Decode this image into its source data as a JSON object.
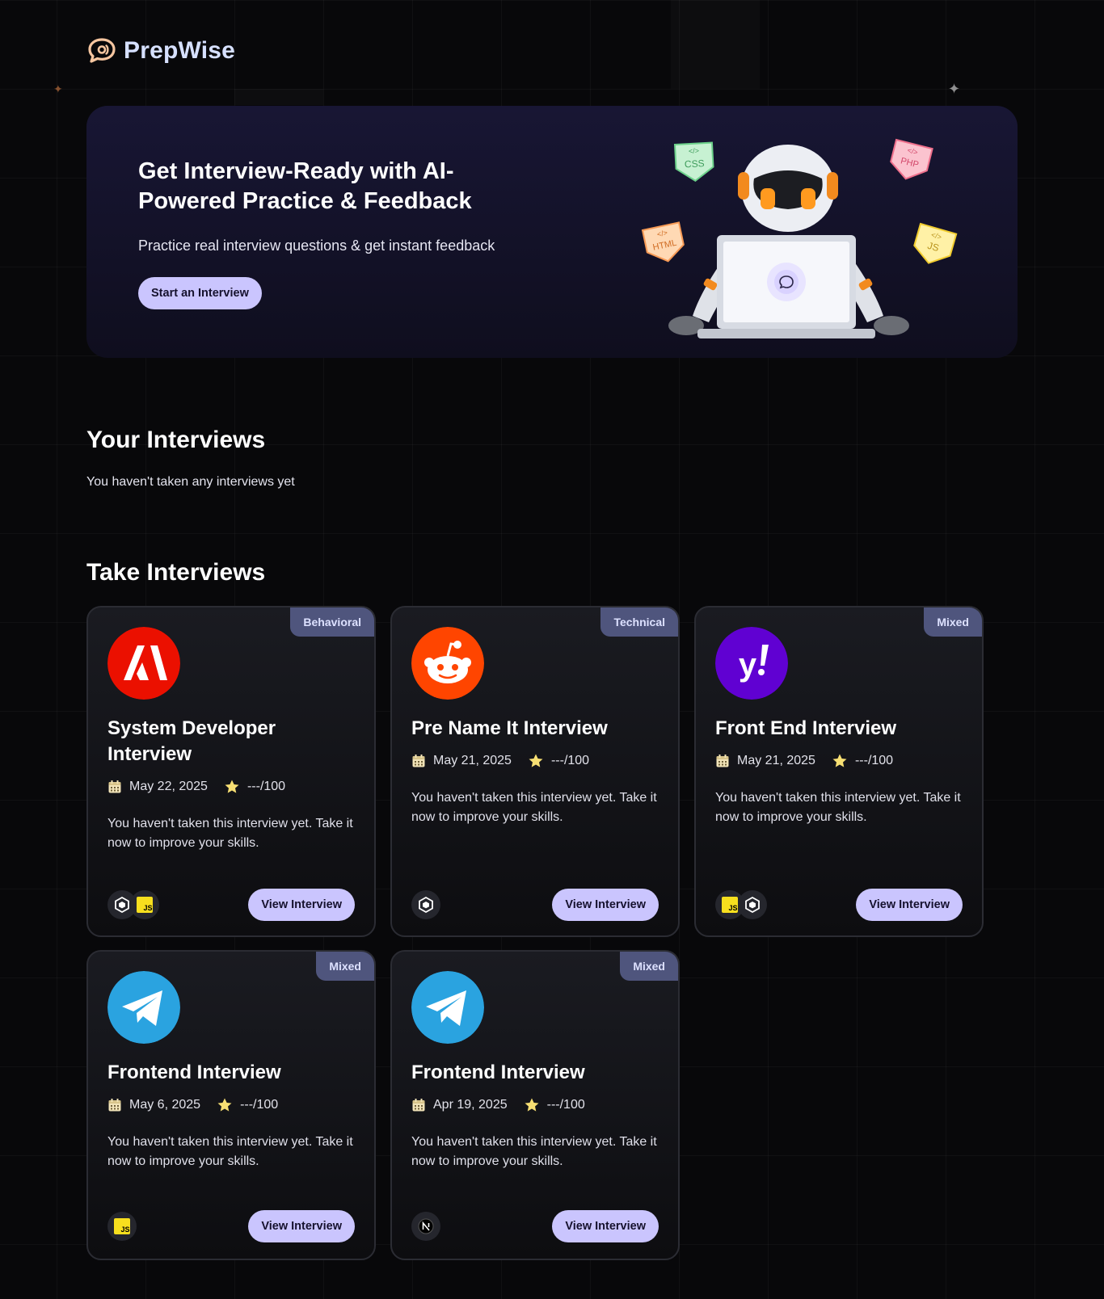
{
  "app": {
    "name": "PrepWise"
  },
  "hero": {
    "title": "Get Interview-Ready with AI-Powered Practice & Feedback",
    "subtitle": "Practice real interview questions & get instant feedback",
    "cta_label": "Start an Interview",
    "art_badges": [
      "CSS",
      "PHP",
      "HTML",
      "JS"
    ]
  },
  "your_interviews": {
    "title": "Your Interviews",
    "empty_text": "You haven't taken any interviews yet"
  },
  "take_interviews": {
    "title": "Take Interviews",
    "cards": [
      {
        "badge": "Behavioral",
        "company_icon": "adobe-logo",
        "brand_color": "#eb1000",
        "title": "System Developer Interview",
        "date": "May 22, 2025",
        "score": "---/100",
        "description": "You haven't taken this interview yet. Take it now to improve your skills.",
        "tech": [
          "webpack-icon",
          "js-icon"
        ],
        "button": "View Interview"
      },
      {
        "badge": "Technical",
        "company_icon": "reddit-logo",
        "brand_color": "#ff4500",
        "title": "Pre Name It Interview",
        "date": "May 21, 2025",
        "score": "---/100",
        "description": "You haven't taken this interview yet. Take it now to improve your skills.",
        "tech": [
          "webpack-icon"
        ],
        "button": "View Interview"
      },
      {
        "badge": "Mixed",
        "company_icon": "yahoo-logo",
        "brand_color": "#6001d2",
        "title": "Front End Interview",
        "date": "May 21, 2025",
        "score": "---/100",
        "description": "You haven't taken this interview yet. Take it now to improve your skills.",
        "tech": [
          "js-icon",
          "webpack-icon"
        ],
        "button": "View Interview"
      },
      {
        "badge": "Mixed",
        "company_icon": "telegram-logo",
        "brand_color": "#2aa3e0",
        "title": "Frontend Interview",
        "date": "May 6, 2025",
        "score": "---/100",
        "description": "You haven't taken this interview yet. Take it now to improve your skills.",
        "tech": [
          "js-icon"
        ],
        "button": "View Interview"
      },
      {
        "badge": "Mixed",
        "company_icon": "telegram-logo",
        "brand_color": "#2aa3e0",
        "title": "Frontend Interview",
        "date": "Apr 19, 2025",
        "score": "---/100",
        "description": "You haven't taken this interview yet. Take it now to improve your skills.",
        "tech": [
          "nextjs-icon"
        ],
        "button": "View Interview"
      }
    ]
  },
  "colors": {
    "accent": "#cac5fe",
    "badge": "#4f557d",
    "background": "#08080a",
    "star": "#f7df73"
  }
}
